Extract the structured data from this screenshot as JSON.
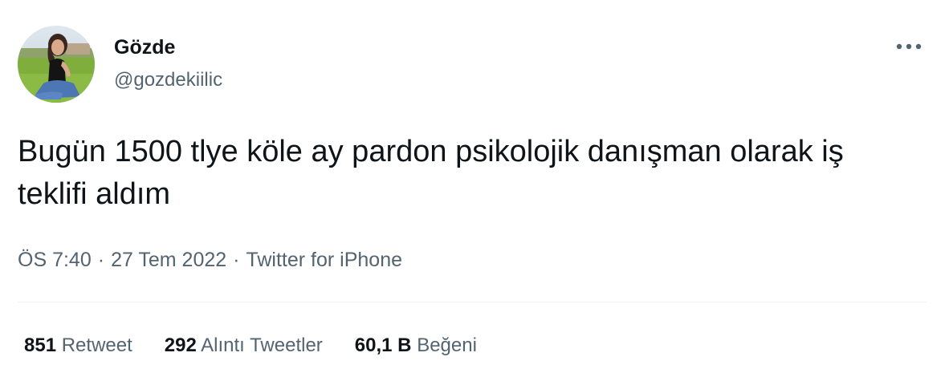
{
  "author": {
    "name": "Gözde",
    "handle": "@gozdekiilic",
    "avatar_icon": "profile-photo"
  },
  "tweet": {
    "text": "Bugün 1500 tlye köle ay pardon psikolojik danışman olarak iş teklifi aldım",
    "time": "ÖS 7:40",
    "separator": "·",
    "date": "27 Tem 2022",
    "source": "Twitter for iPhone"
  },
  "more_icon": "more-horizontal-icon",
  "stats": {
    "retweets": {
      "count": "851",
      "label": "Retweet"
    },
    "quotes": {
      "count": "292",
      "label": "Alıntı Tweetler"
    },
    "likes": {
      "count": "60,1 B",
      "label": "Beğeni"
    }
  },
  "colors": {
    "text_primary": "#0f1419",
    "text_secondary": "#536471",
    "divider": "#eff3f4"
  }
}
